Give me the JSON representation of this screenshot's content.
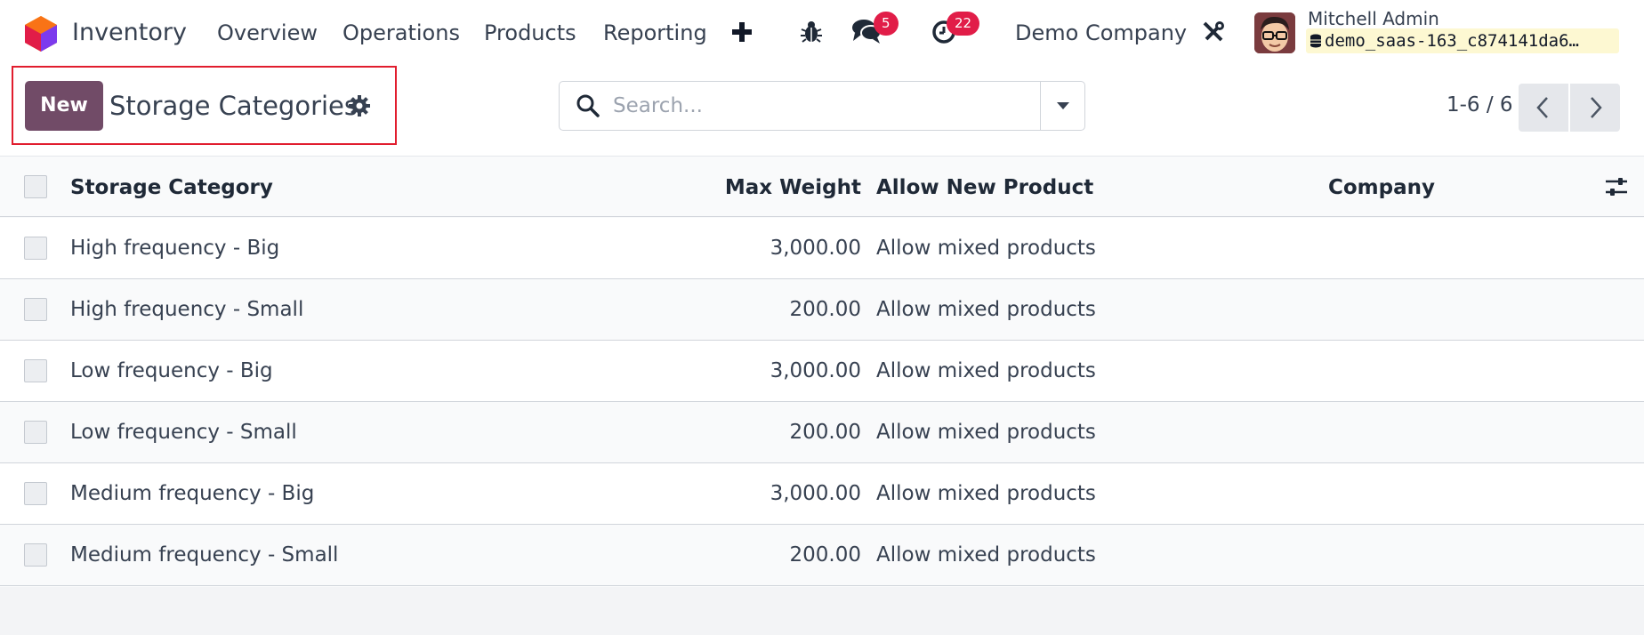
{
  "navbar": {
    "app_name": "Inventory",
    "menu": [
      "Overview",
      "Operations",
      "Products",
      "Reporting"
    ],
    "chat_badge": "5",
    "activity_badge": "22",
    "company": "Demo Company",
    "user_name": "Mitchell Admin",
    "database": "demo_saas-163_c874141da6…"
  },
  "control": {
    "new_label": "New",
    "title": "Storage Categories",
    "search_placeholder": "Search...",
    "pager": "1-6 / 6"
  },
  "table": {
    "columns": [
      "Storage Category",
      "Max Weight",
      "Allow New Product",
      "Company"
    ],
    "rows": [
      {
        "name": "High frequency - Big",
        "weight": "3,000.00",
        "allow": "Allow mixed products",
        "company": ""
      },
      {
        "name": "High frequency - Small",
        "weight": "200.00",
        "allow": "Allow mixed products",
        "company": ""
      },
      {
        "name": "Low frequency - Big",
        "weight": "3,000.00",
        "allow": "Allow mixed products",
        "company": ""
      },
      {
        "name": "Low frequency - Small",
        "weight": "200.00",
        "allow": "Allow mixed products",
        "company": ""
      },
      {
        "name": "Medium frequency - Big",
        "weight": "3,000.00",
        "allow": "Allow mixed products",
        "company": ""
      },
      {
        "name": "Medium frequency - Small",
        "weight": "200.00",
        "allow": "Allow mixed products",
        "company": ""
      }
    ]
  },
  "colors": {
    "primary": "#714b67",
    "badge": "#e11d48",
    "highlight": "#e11d2e"
  },
  "icons": [
    "app-logo-icon",
    "plus-icon",
    "bug-icon",
    "chat-icon",
    "clock-icon",
    "tools-icon",
    "database-icon",
    "gear-icon",
    "search-icon",
    "caret-down-icon",
    "chevron-left-icon",
    "chevron-right-icon",
    "column-settings-icon"
  ]
}
